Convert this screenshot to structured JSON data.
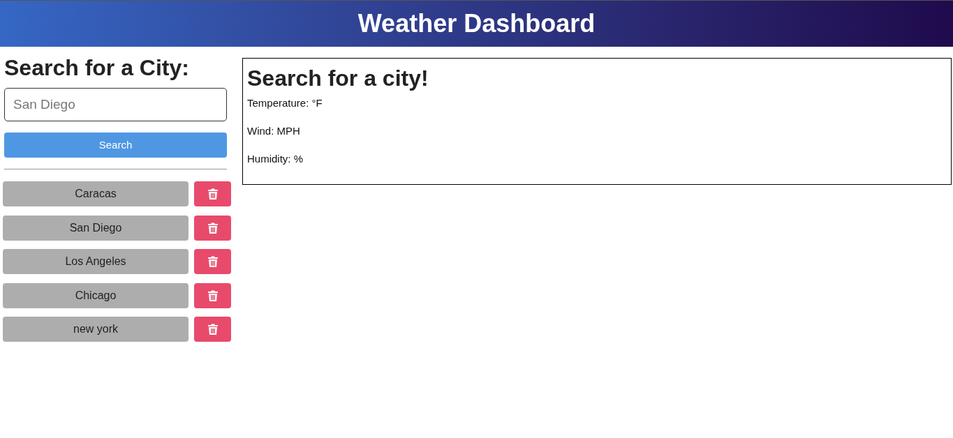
{
  "header": {
    "title": "Weather Dashboard"
  },
  "search": {
    "heading": "Search for a City:",
    "placeholder": "San Diego",
    "button": "Search"
  },
  "history": [
    {
      "city": "Caracas"
    },
    {
      "city": "San Diego"
    },
    {
      "city": "Los Angeles"
    },
    {
      "city": "Chicago"
    },
    {
      "city": "new york"
    }
  ],
  "current": {
    "title": "Search for a city!",
    "lines": [
      "Temperature: °F",
      "Wind: MPH",
      "Humidity: %"
    ]
  }
}
